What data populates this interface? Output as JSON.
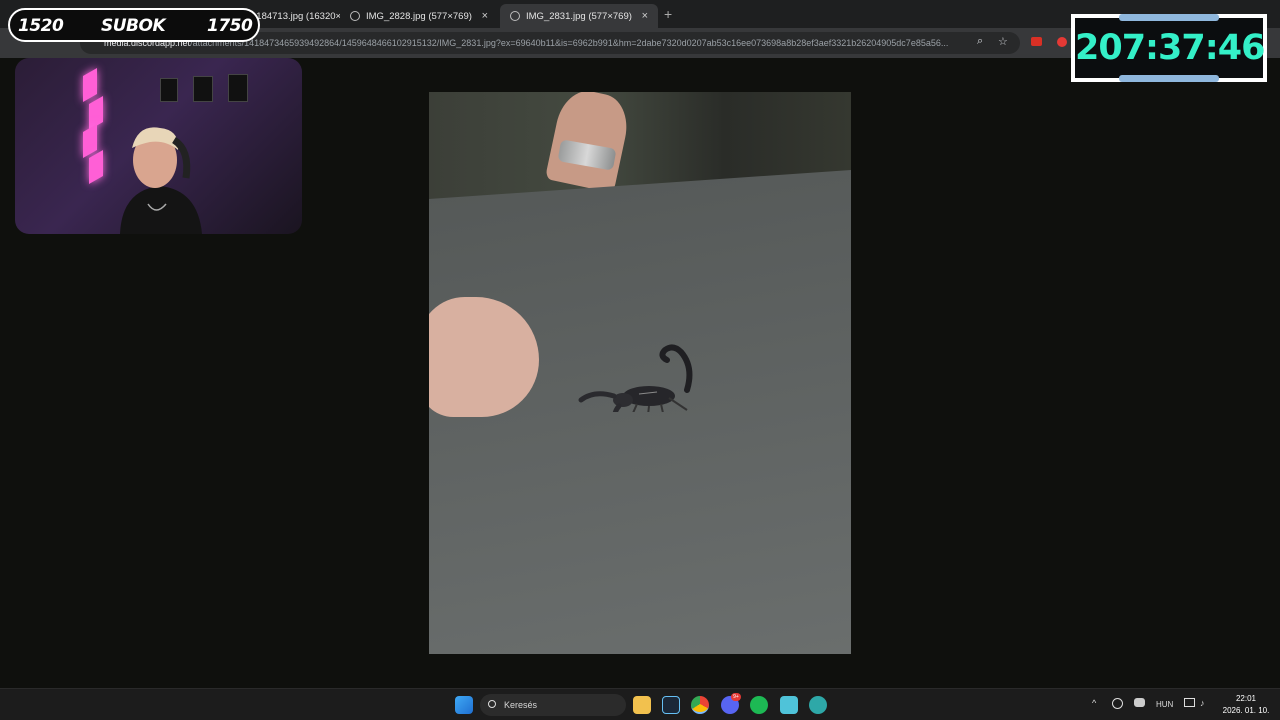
{
  "overlay": {
    "counter_left": "1520",
    "counter_label": "SUBOK",
    "counter_right": "1750",
    "timer": "207:37:46"
  },
  "browser": {
    "tabs": [
      {
        "title": "260110_184713.jpg (16320×",
        "close": "×"
      },
      {
        "title": "IMG_2828.jpg (577×769)",
        "close": "×"
      },
      {
        "title": "IMG_2831.jpg (577×769)",
        "close": "×"
      }
    ],
    "new_tab": "+",
    "url_host": "media.discordapp.net",
    "url_path": "/attachments/1418473465939492864/1459648466102915132/IMG_2831.jpg?ex=69640b11&is=6962b991&hm=2dabe7320d0207ab53c16ee073698a8b28ef3aef3321b26204905dc7e85a56...",
    "zoom_icon": "⌕",
    "star_icon": "☆"
  },
  "taskbar": {
    "search_placeholder": "Keresés",
    "language": "HUN",
    "time": "22:01",
    "date": "2026. 01. 10.",
    "discord_badge": "9+"
  },
  "colors": {
    "timer_text": "#34f0c8",
    "timer_bar": "#8fb7dd",
    "neon": "#ff5fd6"
  }
}
